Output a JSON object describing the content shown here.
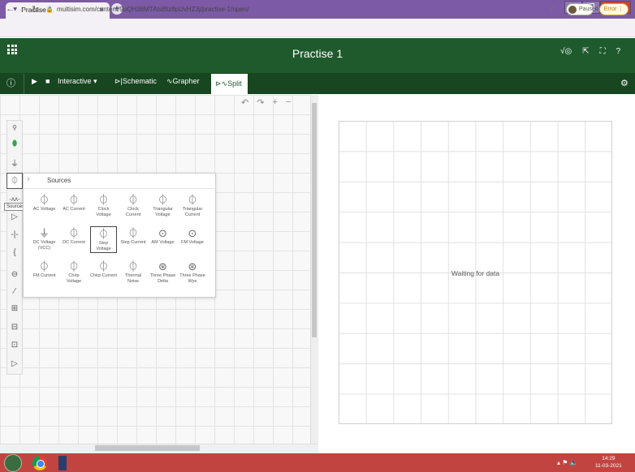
{
  "browser": {
    "tab_title": "Practise 1",
    "url": "multisim.com/content/9uQH38MTAtsBtz8pUvHZ3j/practise-1/open/",
    "paused_label": "Paused",
    "error_label": "Error"
  },
  "app": {
    "title": "Practise 1"
  },
  "toolbar": {
    "interactive_label": "Interactive ▾",
    "schematic_label": "Schematic",
    "grapher_label": "Grapher",
    "split_label": "Split"
  },
  "sidebar": {
    "tooltip": "Sources"
  },
  "sources_panel": {
    "title": "Sources",
    "items": [
      {
        "label": "AC Voltage",
        "icon": "ac-voltage-icon",
        "glyph": "⏀"
      },
      {
        "label": "AC Current",
        "icon": "ac-current-icon",
        "glyph": "⏀"
      },
      {
        "label": "Clock Voltage",
        "icon": "clock-voltage-icon",
        "glyph": "⏀"
      },
      {
        "label": "Clock Current",
        "icon": "clock-current-icon",
        "glyph": "⏀"
      },
      {
        "label": "Triangular Voltage",
        "icon": "triangular-voltage-icon",
        "glyph": "⏀"
      },
      {
        "label": "Triangular Current",
        "icon": "triangular-current-icon",
        "glyph": "⏀"
      },
      {
        "label": "DC Voltage (VCC)",
        "icon": "dc-voltage-icon",
        "glyph": "⏚"
      },
      {
        "label": "DC Current",
        "icon": "dc-current-icon",
        "glyph": "⏀"
      },
      {
        "label": "Step Voltage",
        "icon": "step-voltage-icon",
        "glyph": "⏀"
      },
      {
        "label": "Step Current",
        "icon": "step-current-icon",
        "glyph": "⏀"
      },
      {
        "label": "AM Voltage",
        "icon": "am-voltage-icon",
        "glyph": "⊙"
      },
      {
        "label": "FM Voltage",
        "icon": "fm-voltage-icon",
        "glyph": "⊙"
      },
      {
        "label": "FM Current",
        "icon": "fm-current-icon",
        "glyph": "⏀"
      },
      {
        "label": "Chirp Voltage",
        "icon": "chirp-voltage-icon",
        "glyph": "⏀"
      },
      {
        "label": "Chirp Current",
        "icon": "chirp-current-icon",
        "glyph": "⏀"
      },
      {
        "label": "Thermal Noise",
        "icon": "thermal-noise-icon",
        "glyph": "⏀"
      },
      {
        "label": "Three Phase Delta",
        "icon": "three-phase-delta-icon",
        "glyph": "⊛"
      },
      {
        "label": "Three Phase Wye",
        "icon": "three-phase-wye-icon",
        "glyph": "⊛"
      }
    ]
  },
  "grapher": {
    "status": "Waiting for data"
  },
  "taskbar": {
    "time": "14:29",
    "date": "11-03-2021"
  },
  "colors": {
    "app_header": "#1f5a2c",
    "toolbar": "#174620",
    "browser_frame": "#7c5aa6",
    "taskbar": "#c24440"
  }
}
